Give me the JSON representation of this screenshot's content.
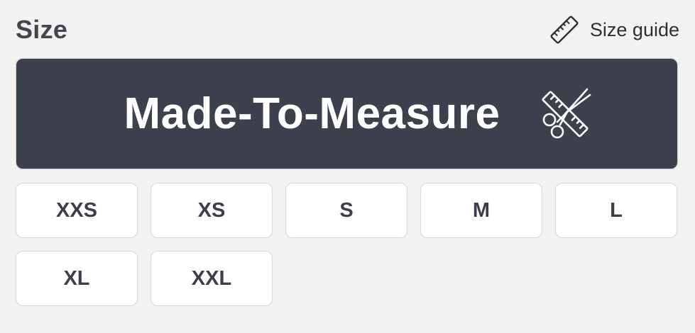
{
  "header": {
    "title": "Size",
    "size_guide_label": "Size guide",
    "size_guide_icon": "ruler-icon"
  },
  "made_to_measure": {
    "label": "Made-To-Measure",
    "icon": "scissors-ruler-icon",
    "background_color": "#3d404d"
  },
  "sizes": [
    {
      "label": "XXS"
    },
    {
      "label": "XS"
    },
    {
      "label": "S"
    },
    {
      "label": "M"
    },
    {
      "label": "L"
    },
    {
      "label": "XL"
    },
    {
      "label": "XXL"
    }
  ]
}
